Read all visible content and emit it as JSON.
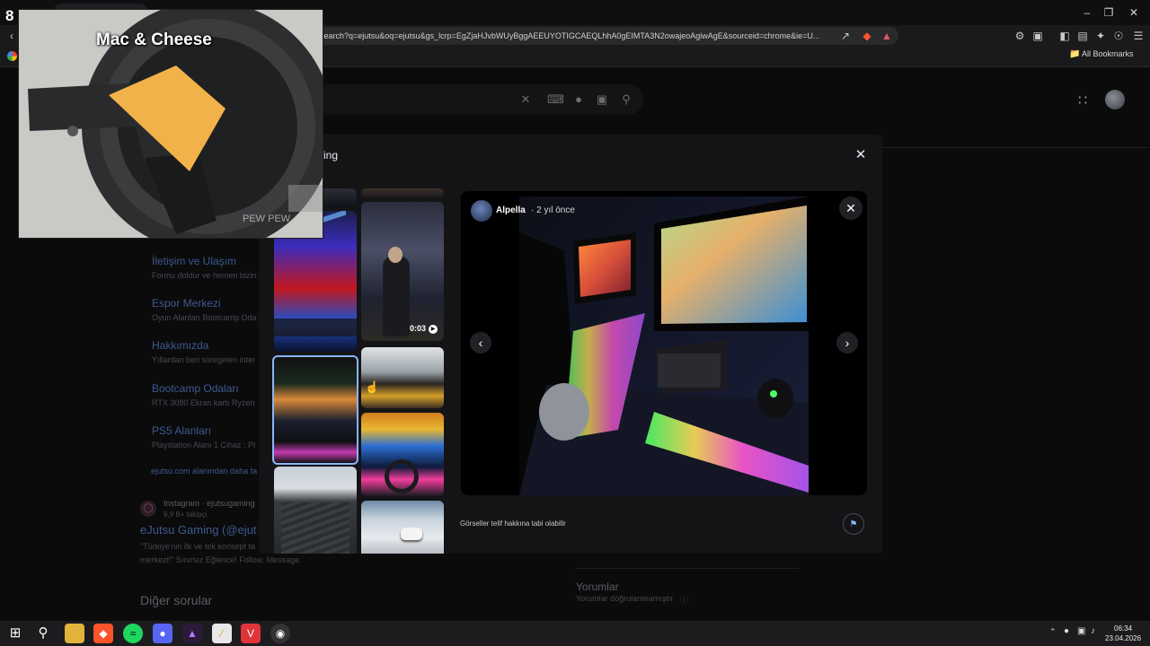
{
  "browser": {
    "url": "search?q=ejutsu&oq=ejutsu&gs_lcrp=EgZjaHJvbWUyBggAEEUYOTIGCAEQLhhA0gEIMTA3N2owajeoAgiwAgE&sourceid=chrome&ie=U...",
    "bookmarks_label": "All Bookmarks"
  },
  "results": {
    "sitelinks": [
      {
        "title": "İletişim ve Ulaşım",
        "desc": "Formu doldur ve hemen bizin"
      },
      {
        "title": "Espor Merkezi",
        "desc": "Oyun Alanları Bootcamp Oda"
      },
      {
        "title": "Hakkımızda",
        "desc": "Yıllardan beri süregelen inter"
      },
      {
        "title": "Bootcamp Odaları",
        "desc": "RTX 3080 Ekran kartı Ryzen"
      },
      {
        "title": "PS5 Alanları",
        "desc": "Playstation Alanı 1 Cihaz : Pl"
      }
    ],
    "more_from": "ejutsu.com alanından daha fa",
    "instagram": {
      "source": "Instagram · ejutsugaming",
      "followers": "9,9 B+ takipçi",
      "title": "eJutsu Gaming (@ejut",
      "snippet1": "\"Türkiye'nin ilk ve tek konsept ta",
      "snippet2": "merkezi!\" Sınırsız Eğlence! Follow. Message."
    },
    "other_questions": "Diğer sorular",
    "reviews": {
      "title": "Yorumlar",
      "subtitle": "Yorumlar doğrulanmamıştır"
    }
  },
  "modal": {
    "title": "ming",
    "video_duration": "0:03",
    "author": "Alpella",
    "age": "· 2 yıl önce",
    "copyright": "Görseller telif hakkına tabi olabilir"
  },
  "pip": {
    "title": "Mac & Cheese",
    "corner_number": "8",
    "watermark": "PEW PEW"
  },
  "taskbar": {
    "time": "06:34",
    "date": "23.04.2026"
  }
}
